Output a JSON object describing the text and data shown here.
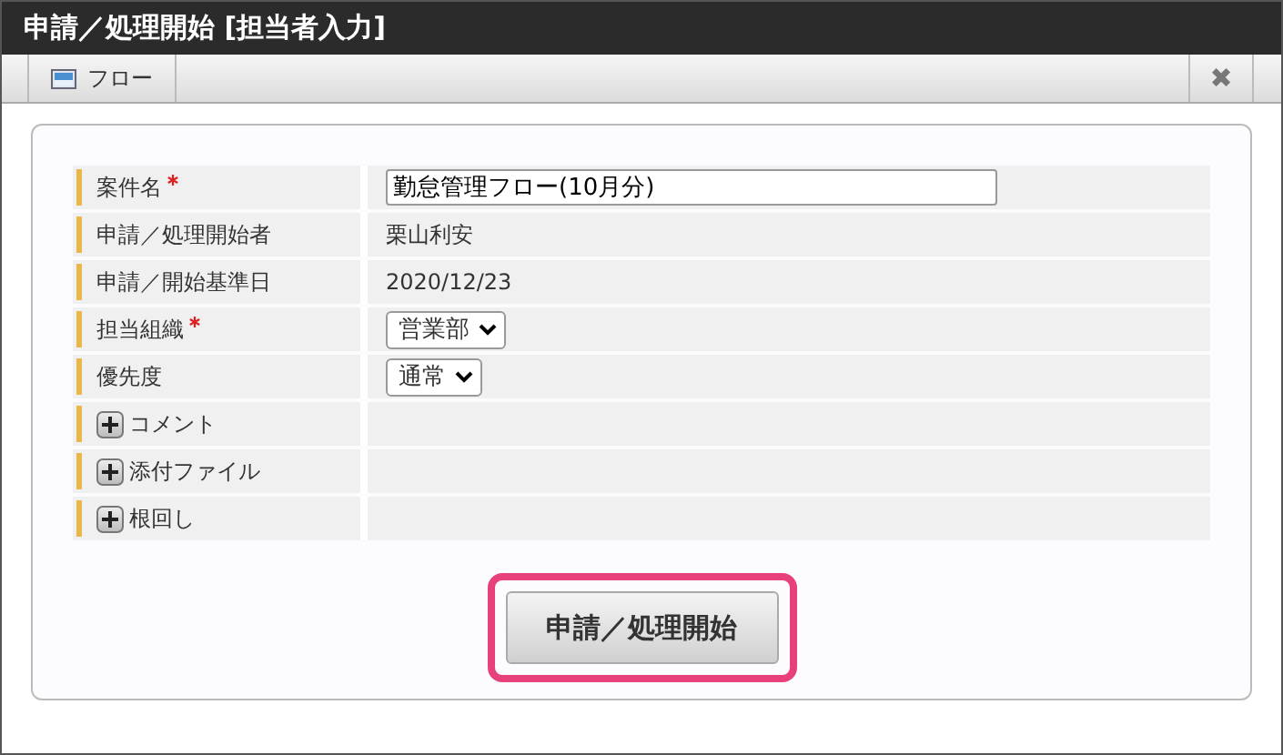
{
  "window": {
    "title": "申請／処理開始 [担当者入力]"
  },
  "toolbar": {
    "tab": {
      "label": "フロー"
    },
    "close": "✖"
  },
  "form": {
    "rows": [
      {
        "kind": "input",
        "label": "案件名",
        "required": true,
        "value": "勤怠管理フロー(10月分)"
      },
      {
        "kind": "text",
        "label": "申請／処理開始者",
        "required": false,
        "value": "栗山利安"
      },
      {
        "kind": "text",
        "label": "申請／開始基準日",
        "required": false,
        "value": "2020/12/23"
      },
      {
        "kind": "select",
        "label": "担当組織",
        "required": true,
        "value": "営業部"
      },
      {
        "kind": "select",
        "label": "優先度",
        "required": false,
        "value": "通常"
      },
      {
        "kind": "expand",
        "label": "コメント",
        "required": false,
        "expanded": false
      },
      {
        "kind": "expand",
        "label": "添付ファイル",
        "required": false,
        "expanded": false
      },
      {
        "kind": "expand",
        "label": "根回し",
        "required": false,
        "expanded": false
      }
    ]
  },
  "submit": {
    "label": "申請／処理開始",
    "highlighted": true
  }
}
